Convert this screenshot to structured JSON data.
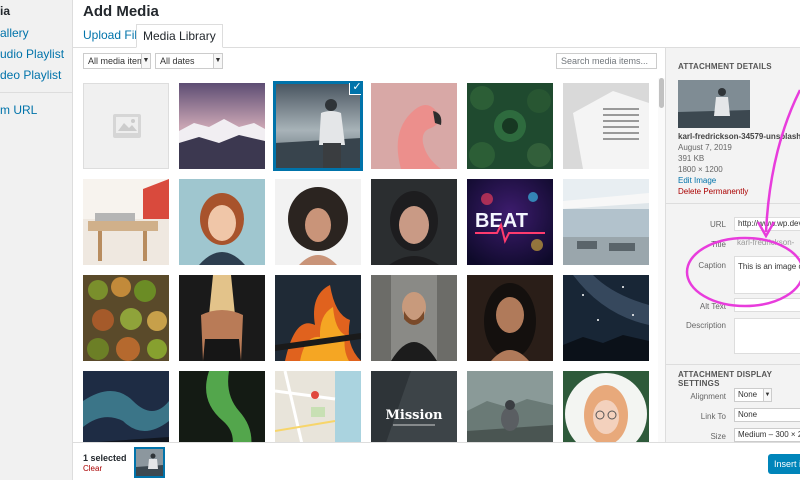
{
  "left_menu": {
    "items": [
      {
        "label": "ia"
      },
      {
        "label": "allery"
      },
      {
        "label": "udio Playlist"
      },
      {
        "label": "deo Playlist"
      },
      {
        "label": "m URL"
      }
    ]
  },
  "modal": {
    "title": "Add Media",
    "tabs": [
      {
        "label": "Upload Files"
      },
      {
        "label": "Media Library"
      }
    ],
    "filters": {
      "type_value": "All media items",
      "date_value": "All dates",
      "search_placeholder": "Search media items..."
    }
  },
  "grid": {
    "items": [
      {
        "name": "placeholder-image",
        "icon": "image-placeholder-icon"
      },
      {
        "name": "mountain-sunset"
      },
      {
        "name": "man-on-hill",
        "selected": true
      },
      {
        "name": "flamingo"
      },
      {
        "name": "pine-trees-aerial"
      },
      {
        "name": "book-pages"
      },
      {
        "name": "desk-table"
      },
      {
        "name": "redhead-woman"
      },
      {
        "name": "curly-hair-woman"
      },
      {
        "name": "woman-portrait-dark"
      },
      {
        "name": "neon-beat-sign"
      },
      {
        "name": "modern-house-patio"
      },
      {
        "name": "vegetables-market"
      },
      {
        "name": "woman-back"
      },
      {
        "name": "fire-flames"
      },
      {
        "name": "bearded-man-glasses"
      },
      {
        "name": "woman-long-hair"
      },
      {
        "name": "milky-way"
      },
      {
        "name": "aurora-green"
      },
      {
        "name": "aurora-bright"
      },
      {
        "name": "map-city"
      },
      {
        "name": "mission-logo",
        "text": "Mission"
      },
      {
        "name": "hiker-foggy"
      },
      {
        "name": "woman-glasses-circle"
      }
    ]
  },
  "sidebar": {
    "heading": "ATTACHMENT DETAILS",
    "filename": "karl-fredrickson-34579-unsplash.",
    "date": "August 7, 2019",
    "filesize": "391 KB",
    "dimensions": "1800 × 1200",
    "edit_label": "Edit Image",
    "delete_label": "Delete Permanently",
    "fields": {
      "url_label": "URL",
      "url_value": "http://www.wp.dev",
      "title_label": "Title",
      "title_value": "karl-fredrickson-",
      "caption_label": "Caption",
      "caption_value": "This is an image c",
      "alt_label": "Alt Text",
      "description_label": "Description"
    },
    "display": {
      "heading": "ATTACHMENT DISPLAY SETTINGS",
      "alignment_label": "Alignment",
      "alignment_value": "None",
      "link_label": "Link To",
      "link_value": "None",
      "size_label": "Size",
      "size_value": "Medium – 300 × 2"
    }
  },
  "bottom": {
    "selected_count": "1 selected",
    "clear_label": "Clear",
    "insert_label": "Insert i"
  },
  "colors": {
    "accent": "#0073aa",
    "annotation": "#e83cdc",
    "delete": "#a00000"
  }
}
